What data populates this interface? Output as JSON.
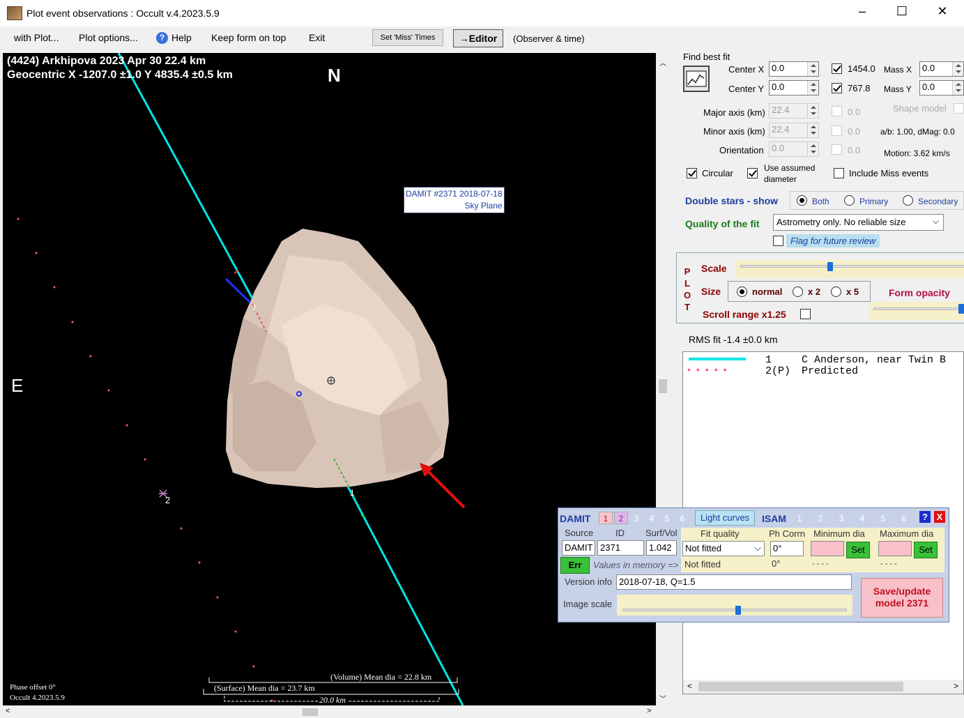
{
  "window": {
    "title": "Plot event observations : Occult v.4.2023.5.9",
    "minimize": "–",
    "maximize": "☐",
    "close": "✕"
  },
  "menu": {
    "with_plot": "with Plot...",
    "plot_options": "Plot options...",
    "help": "Help",
    "keep_on_top": "Keep form on top",
    "exit": "Exit",
    "set_miss_times": "Set 'Miss' Times",
    "editor": "→Editor",
    "observer_time": "(Observer & time)"
  },
  "plot": {
    "header_line1": "(4424) Arkhipova  2023 Apr 30   22.4 km",
    "header_line2": "Geocentric  X  -1207.0 ±1.0  Y 4835.4 ±0.5 km",
    "north": "N",
    "east": "E",
    "damit_label_1": "DAMIT #2371 2018-07-18",
    "damit_label_2": "Sky Plane",
    "chord_1_label": "1",
    "chord_1b_label": "1",
    "chord_2_label": "2",
    "volume_dia": "(Volume) Mean dia = 22.8 km",
    "surface_dia": "(Surface) Mean dia = 23.7 km",
    "scale_bar": "20.0 km",
    "phase_offset": "Phase offset 0°",
    "version": "Occult 4.2023.5.9"
  },
  "fit": {
    "find_best_fit": "Find best fit",
    "center_x_label": "Center X",
    "center_x": "0.0",
    "center_y_label": "Center Y",
    "center_y": "0.0",
    "cx_val": "1454.0",
    "cy_val": "767.8",
    "mass_x_label": "Mass X",
    "mass_x": "0.0",
    "mass_y_label": "Mass Y",
    "mass_y": "0.0",
    "major_label": "Major axis (km)",
    "major": "22.4",
    "minor_label": "Minor axis (km)",
    "minor": "22.4",
    "orient_label": "Orientation",
    "orient": "0.0",
    "zero1": "0.0",
    "zero2": "0.0",
    "zero3": "0.0",
    "shape_model": "Shape model",
    "ab_dmag": "a/b: 1.00, dMag: 0.0",
    "motion": "Motion: 3.62 km/s",
    "circular": "Circular",
    "use_assumed_1": "Use assumed",
    "use_assumed_2": "diameter",
    "include_miss": "Include Miss events"
  },
  "double_stars": {
    "label": "Double stars - show",
    "both": "Both",
    "primary": "Primary",
    "secondary": "Secondary"
  },
  "quality": {
    "label": "Quality of the fit",
    "value": "Astrometry only. No reliable size",
    "flag": "Flag for future review"
  },
  "plotbox": {
    "vert": [
      "P",
      "L",
      "O",
      "T"
    ],
    "scale": "Scale",
    "size": "Size",
    "normal": "normal",
    "x2": "x 2",
    "x5": "x 5",
    "form_opacity": "Form opacity",
    "scroll_range": "Scroll range x1.25"
  },
  "rms": "RMS fit -1.4 ±0.0 km",
  "legend": {
    "row1_num": "1",
    "row1_text": "C Anderson, near Twin B",
    "row2_num": "2(P)",
    "row2_text": "Predicted"
  },
  "damit": {
    "title": "DAMIT",
    "nums": [
      "1",
      "2",
      "3",
      "4",
      "5",
      "6"
    ],
    "light_curves": "Light curves",
    "isam": "ISAM",
    "isam_nums": [
      "1",
      "2",
      "3",
      "4",
      "5",
      "6"
    ],
    "help": "?",
    "close": "X",
    "source_label": "Source",
    "id_label": "ID",
    "surfvol_label": "Surf/Vol",
    "fitq_label": "Fit quality",
    "phcorr_label": "Ph Corrn",
    "mindia_label": "Minimum dia",
    "maxdia_label": "Maximum dia",
    "source": "DAMIT",
    "id": "2371",
    "surfvol": "1.042",
    "fitq": "Not fitted",
    "phcorr": "0°",
    "set1": "Set",
    "set2": "Set",
    "err": "Err",
    "values_in_memory": "Values in memory =>",
    "fitq_mem": "Not fitted",
    "phcorr_mem": "0°",
    "dash1": "- - - -",
    "dash2": "- - - -",
    "version_label": "Version info",
    "version": "2018-07-18, Q=1.5",
    "image_scale_label": "Image scale",
    "save_1": "Save/update",
    "save_2": "model 2371"
  },
  "colors": {
    "chord1": "#00e5e5",
    "predicted": "#ff5599",
    "asteroid": "#d9c5b8"
  }
}
